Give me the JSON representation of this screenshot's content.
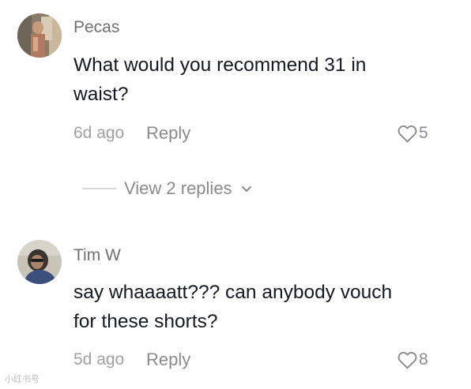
{
  "comments": [
    {
      "username": "Pecas",
      "text_line1": "What would you recommend 31 in",
      "text_line2": "waist?",
      "time": "6d ago",
      "reply_label": "Reply",
      "like_count": "5",
      "avatar_icon": "person-photo-icon"
    },
    {
      "username": "Tim W",
      "text_line1": "say whaaaatt??? can anybody vouch",
      "text_line2": "for these shorts?",
      "time": "5d ago",
      "reply_label": "Reply",
      "like_count": "8",
      "avatar_icon": "person-photo-icon"
    }
  ],
  "view_replies": {
    "label": "View 2 replies",
    "icon": "chevron-down-icon"
  },
  "watermark": "小红书号",
  "colors": {
    "text_primary": "#161823",
    "text_secondary": "#8a8b91",
    "username": "#6f7077"
  }
}
